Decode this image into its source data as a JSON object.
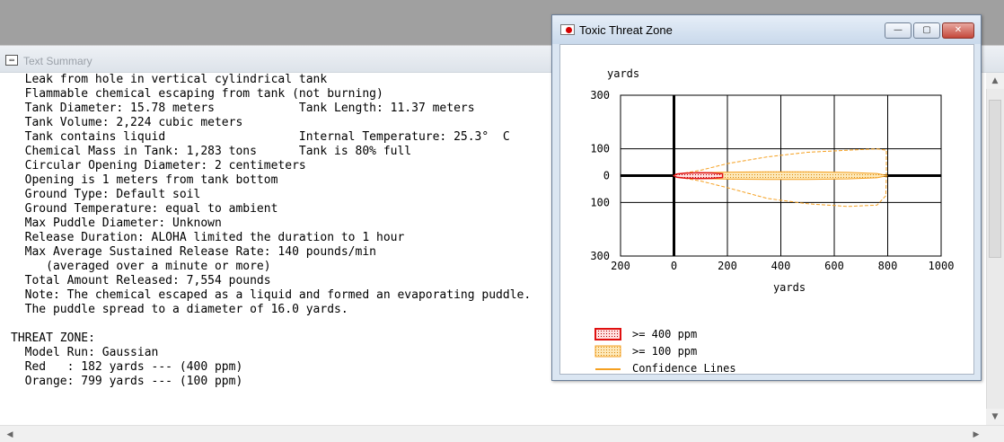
{
  "text_summary": {
    "title": "Text Summary",
    "icon": "document-icon",
    "lines": [
      "  Leak from hole in vertical cylindrical tank",
      "  Flammable chemical escaping from tank (not burning)",
      "  Tank Diameter: 15.78 meters            Tank Length: 11.37 meters",
      "  Tank Volume: 2,224 cubic meters",
      "  Tank contains liquid                   Internal Temperature: 25.3°  C",
      "  Chemical Mass in Tank: 1,283 tons      Tank is 80% full",
      "  Circular Opening Diameter: 2 centimeters",
      "  Opening is 1 meters from tank bottom",
      "  Ground Type: Default soil",
      "  Ground Temperature: equal to ambient",
      "  Max Puddle Diameter: Unknown",
      "  Release Duration: ALOHA limited the duration to 1 hour",
      "  Max Average Sustained Release Rate: 140 pounds/min",
      "     (averaged over a minute or more)",
      "  Total Amount Released: 7,554 pounds",
      "  Note: The chemical escaped as a liquid and formed an evaporating puddle.",
      "  The puddle spread to a diameter of 16.0 yards.",
      "",
      "THREAT ZONE:",
      "  Model Run: Gaussian",
      "  Red   : 182 yards --- (400 ppm)",
      "  Orange: 799 yards --- (100 ppm)"
    ]
  },
  "threat_zone_window": {
    "title": "Toxic Threat Zone",
    "buttons": {
      "minimize": "—",
      "maximize": "▢",
      "close": "✕"
    },
    "legend": [
      {
        "label": ">= 400 ppm",
        "color": "#e01010"
      },
      {
        "label": ">= 100 ppm",
        "color": "#f5a020"
      },
      {
        "label": "Confidence Lines",
        "color": "#f5a020"
      }
    ]
  },
  "chart_data": {
    "type": "area",
    "xlabel": "yards",
    "ylabel": "yards",
    "xlim": [
      -200,
      1000
    ],
    "ylim": [
      -300,
      300
    ],
    "x_ticks": [
      "200",
      "0",
      "200",
      "400",
      "600",
      "800",
      "1000"
    ],
    "x_tick_values": [
      -200,
      0,
      200,
      400,
      600,
      800,
      1000
    ],
    "y_ticks": [
      "300",
      "100",
      "0",
      "100",
      "300"
    ],
    "y_tick_values": [
      300,
      100,
      0,
      -100,
      -300
    ],
    "zones": [
      {
        "name": ">= 400 ppm",
        "color": "#e01010",
        "extent_x": 182,
        "points": [
          [
            0,
            0
          ],
          [
            10,
            -6
          ],
          [
            40,
            -9
          ],
          [
            90,
            -11
          ],
          [
            140,
            -10
          ],
          [
            182,
            -7
          ],
          [
            182,
            7
          ],
          [
            140,
            10
          ],
          [
            90,
            11
          ],
          [
            40,
            9
          ],
          [
            10,
            6
          ]
        ]
      },
      {
        "name": ">= 100 ppm",
        "color": "#f5a020",
        "extent_x": 799,
        "points": [
          [
            0,
            0
          ],
          [
            20,
            -7
          ],
          [
            100,
            -11
          ],
          [
            200,
            -13
          ],
          [
            350,
            -14
          ],
          [
            500,
            -14
          ],
          [
            650,
            -12
          ],
          [
            760,
            -8
          ],
          [
            799,
            0
          ],
          [
            760,
            8
          ],
          [
            650,
            12
          ],
          [
            500,
            14
          ],
          [
            350,
            14
          ],
          [
            200,
            13
          ],
          [
            100,
            11
          ],
          [
            20,
            7
          ]
        ]
      }
    ],
    "confidence_lines": [
      [
        [
          0,
          0
        ],
        [
          30,
          -8
        ],
        [
          100,
          -20
        ],
        [
          200,
          -45
        ],
        [
          350,
          -85
        ],
        [
          500,
          -105
        ],
        [
          650,
          -115
        ],
        [
          760,
          -110
        ],
        [
          793,
          -75
        ],
        [
          795,
          0
        ]
      ],
      [
        [
          0,
          0
        ],
        [
          30,
          8
        ],
        [
          100,
          20
        ],
        [
          200,
          45
        ],
        [
          350,
          70
        ],
        [
          500,
          87
        ],
        [
          650,
          95
        ],
        [
          760,
          100
        ],
        [
          795,
          95
        ],
        [
          795,
          0
        ]
      ]
    ]
  },
  "scrollbars": {
    "up": "▲",
    "down": "▼",
    "left": "◀",
    "right": "▶"
  }
}
